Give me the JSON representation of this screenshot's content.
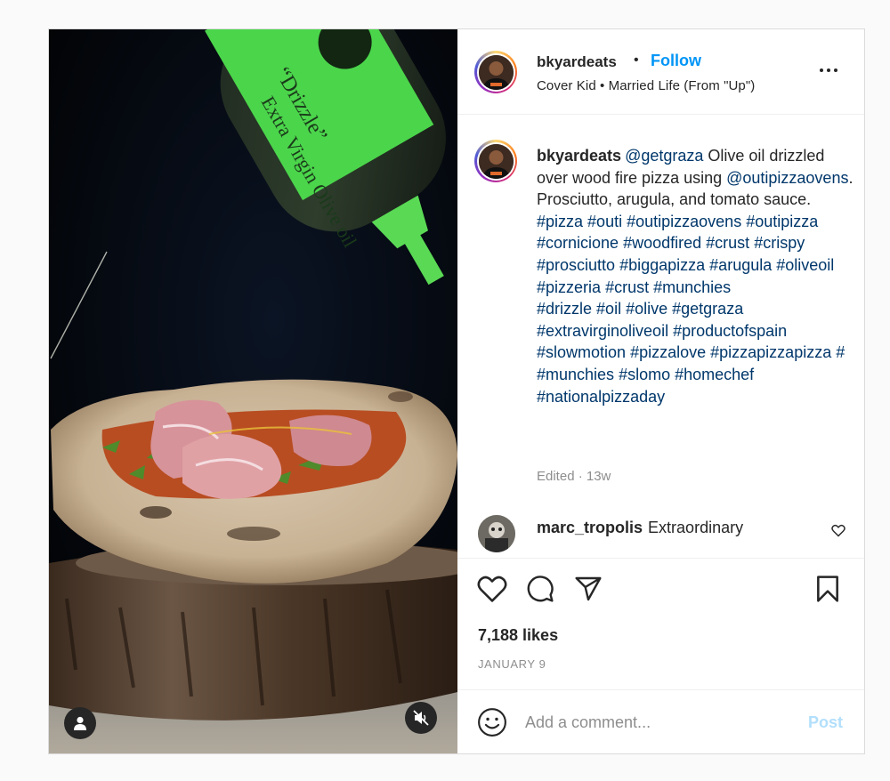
{
  "post": {
    "media": {
      "media_type": "video",
      "user_tag_icon": "user-icon",
      "mute_icon": "speaker-muted-icon",
      "bottle_label": {
        "line1": "Extra Virgin Olive oil",
        "line2": "“Drizzle”"
      }
    },
    "header": {
      "username": "bkyardeats",
      "separator": "•",
      "follow_label": "Follow",
      "audio": "Cover Kid • Married Life (From \"Up\")",
      "more_icon": "more-options-icon"
    },
    "caption": {
      "username": "bkyardeats",
      "mention_1": "@getgraza",
      "text_1": " Olive oil drizzled over wood fire pizza using ",
      "mention_2": "@outipizzaovens",
      "text_2": ". Prosciutto, arugula, and tomato sauce.",
      "hashtags_1": [
        "#pizza",
        "#outi",
        "#outipizzaovens",
        "#outipizza",
        "#cornicione",
        "#woodfired",
        "#crust",
        "#crispy",
        "#prosciutto",
        "#biggapizza",
        "#arugula",
        "#oliveoil",
        "#pizzeria",
        "#crust",
        "#munchies"
      ],
      "hashtags_2": [
        "#drizzle",
        "#oil",
        "#olive",
        "#getgraza",
        "#extravirginoliveoil",
        "#productofspain",
        "#slowmotion",
        "#pizzalove",
        "#pizzapizzapizza",
        "#",
        "#munchies",
        "#slomo",
        "#homechef",
        "#nationalpizzaday"
      ],
      "edited": "Edited · 13w"
    },
    "comment": {
      "username": "marc_tropolis",
      "text": "Extraordinary",
      "like_icon": "heart-outline-icon"
    },
    "actions": {
      "like_icon": "heart-icon",
      "comment_icon": "comment-bubble-icon",
      "share_icon": "paper-plane-icon",
      "save_icon": "bookmark-icon"
    },
    "likes": "7,188 likes",
    "date": "JANUARY 9",
    "composer": {
      "emoji_icon": "smiley-icon",
      "placeholder": "Add a comment...",
      "post_label": "Post",
      "post_color": "#b2dffc"
    },
    "colors": {
      "accent": "#0095f6",
      "link": "#00376b",
      "muted": "#8e8e8e"
    }
  }
}
